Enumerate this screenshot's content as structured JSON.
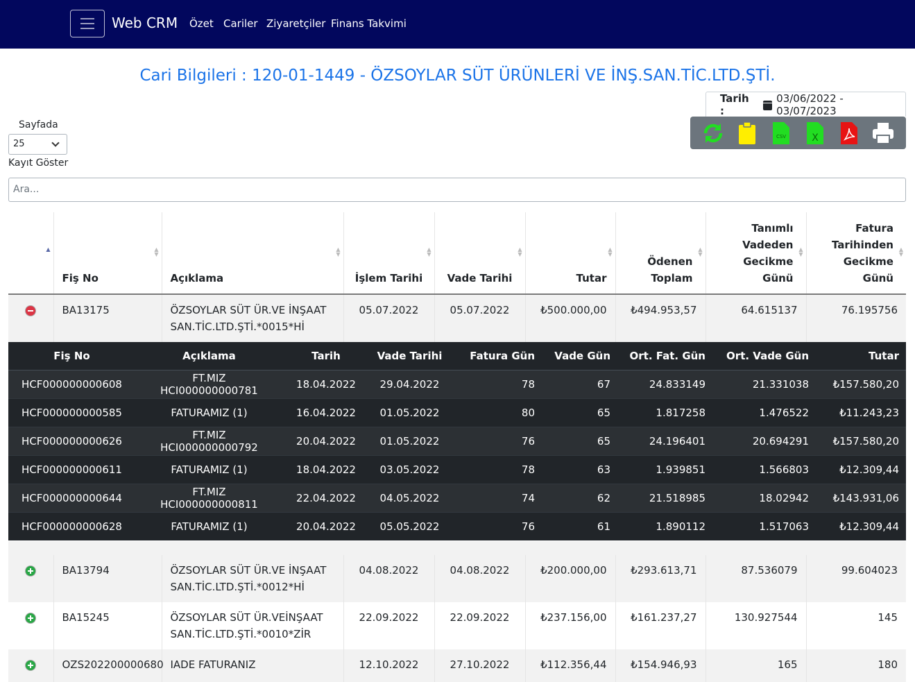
{
  "nav": {
    "brand": "Web CRM",
    "links": [
      "Özet",
      "Cariler",
      "Ziyaretçiler",
      "Finans Takvimi"
    ]
  },
  "page_title": "Cari Bilgileri : 120-01-1449 - ÖZSOYLAR SÜT ÜRÜNLERİ VE İNŞ.SAN.TİC.LTD.ŞTİ.",
  "date_filter": {
    "label": "Tarih :",
    "value": "03/06/2022 - 03/07/2023"
  },
  "length": {
    "label_top": "Sayfada",
    "value": "25",
    "label_bottom": "Kayıt Göster"
  },
  "search": {
    "placeholder": "Ara..."
  },
  "colors": {
    "navbar": "#02075d",
    "title": "#1a73e8",
    "toolbar": "#6c757d"
  },
  "toolbar_icons": [
    "refresh-icon",
    "clipboard-icon",
    "csv-icon",
    "excel-icon",
    "pdf-icon",
    "print-icon"
  ],
  "main_headers": [
    "Fiş No",
    "Açıklama",
    "İşlem Tarihi",
    "Vade Tarihi",
    "Tutar",
    "Ödenen Toplam",
    "Tanımlı Vadeden Gecikme Günü",
    "Fatura Tarihinden Gecikme Günü"
  ],
  "expanded_row": {
    "fis_no": "BA13175",
    "aciklama": "ÖZSOYLAR SÜT ÜR.VE İNŞAAT SAN.TİC.LTD.ŞTİ.*0015*Hİ",
    "islem_tarihi": "05.07.2022",
    "vade_tarihi": "05.07.2022",
    "tutar": "₺500.000,00",
    "odenen": "₺494.953,57",
    "vade_gecikme": "64.615137",
    "fatura_gecikme": "76.195756"
  },
  "sub_headers": [
    "Fiş No",
    "Açıklama",
    "Tarih",
    "Vade Tarihi",
    "Fatura Gün",
    "Vade Gün",
    "Ort. Fat. Gün",
    "Ort. Vade Gün",
    "Tutar"
  ],
  "sub_rows": [
    [
      "HCF000000000608",
      "FT.MIZ HCI000000000781",
      "18.04.2022",
      "29.04.2022",
      "78",
      "67",
      "24.833149",
      "21.331038",
      "₺157.580,20"
    ],
    [
      "HCF000000000585",
      "FATURAMIZ (1)",
      "16.04.2022",
      "01.05.2022",
      "80",
      "65",
      "1.817258",
      "1.476522",
      "₺11.243,23"
    ],
    [
      "HCF000000000626",
      "FT.MIZ HCI000000000792",
      "20.04.2022",
      "01.05.2022",
      "76",
      "65",
      "24.196401",
      "20.694291",
      "₺157.580,20"
    ],
    [
      "HCF000000000611",
      "FATURAMIZ (1)",
      "18.04.2022",
      "03.05.2022",
      "78",
      "63",
      "1.939851",
      "1.566803",
      "₺12.309,44"
    ],
    [
      "HCF000000000644",
      "FT.MIZ HCI000000000811",
      "22.04.2022",
      "04.05.2022",
      "74",
      "62",
      "21.518985",
      "18.02942",
      "₺143.931,06"
    ],
    [
      "HCF000000000628",
      "FATURAMIZ (1)",
      "20.04.2022",
      "05.05.2022",
      "76",
      "61",
      "1.890112",
      "1.517063",
      "₺12.309,44"
    ]
  ],
  "rows": [
    {
      "fis_no": "BA13794",
      "aciklama": "ÖZSOYLAR SÜT ÜR.VE İNŞAAT SAN.TİC.LTD.ŞTİ.*0012*Hİ",
      "islem_tarihi": "04.08.2022",
      "vade_tarihi": "04.08.2022",
      "tutar": "₺200.000,00",
      "odenen": "₺293.613,71",
      "vade_gecikme": "87.536079",
      "fatura_gecikme": "99.604023"
    },
    {
      "fis_no": "BA15245",
      "aciklama": "ÖZSOYLAR SÜT ÜR.VEİNŞAAT SAN.TİC.LTD.ŞTİ.*0010*ZİR",
      "islem_tarihi": "22.09.2022",
      "vade_tarihi": "22.09.2022",
      "tutar": "₺237.156,00",
      "odenen": "₺161.237,27",
      "vade_gecikme": "130.927544",
      "fatura_gecikme": "145"
    },
    {
      "fis_no": "OZS202200000680",
      "aciklama": "IADE FATURANIZ",
      "islem_tarihi": "12.10.2022",
      "vade_tarihi": "27.10.2022",
      "tutar": "₺112.356,44",
      "odenen": "₺154.946,93",
      "vade_gecikme": "165",
      "fatura_gecikme": "180"
    }
  ]
}
